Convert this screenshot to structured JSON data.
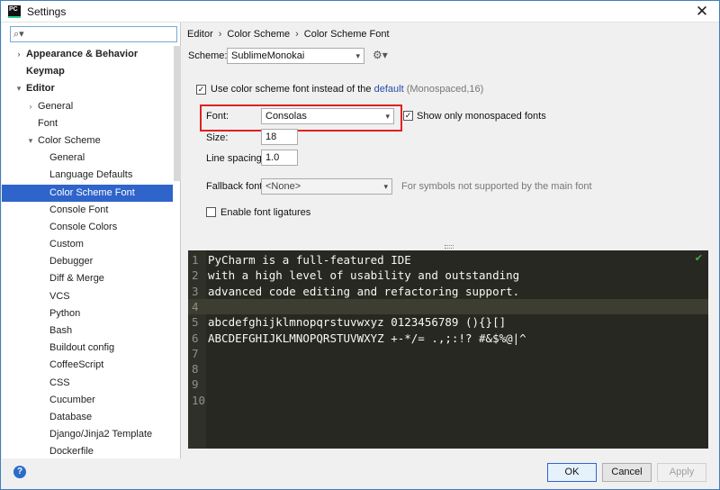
{
  "window": {
    "title": "Settings",
    "app_icon_text": "PC"
  },
  "sidebar": {
    "search": {
      "value": "",
      "placeholder": ""
    },
    "items": [
      {
        "label": "Appearance & Behavior",
        "level": 0,
        "bold": true,
        "arrow": "right"
      },
      {
        "label": "Keymap",
        "level": 0,
        "bold": true,
        "arrow": ""
      },
      {
        "label": "Editor",
        "level": 0,
        "bold": true,
        "arrow": "down"
      },
      {
        "label": "General",
        "level": 1,
        "bold": false,
        "arrow": "right"
      },
      {
        "label": "Font",
        "level": 1,
        "bold": false,
        "arrow": ""
      },
      {
        "label": "Color Scheme",
        "level": 1,
        "bold": false,
        "arrow": "down"
      },
      {
        "label": "General",
        "level": 2,
        "bold": false,
        "arrow": ""
      },
      {
        "label": "Language Defaults",
        "level": 2,
        "bold": false,
        "arrow": ""
      },
      {
        "label": "Color Scheme Font",
        "level": 2,
        "bold": false,
        "arrow": "",
        "selected": true
      },
      {
        "label": "Console Font",
        "level": 2,
        "bold": false,
        "arrow": ""
      },
      {
        "label": "Console Colors",
        "level": 2,
        "bold": false,
        "arrow": ""
      },
      {
        "label": "Custom",
        "level": 2,
        "bold": false,
        "arrow": ""
      },
      {
        "label": "Debugger",
        "level": 2,
        "bold": false,
        "arrow": ""
      },
      {
        "label": "Diff & Merge",
        "level": 2,
        "bold": false,
        "arrow": ""
      },
      {
        "label": "VCS",
        "level": 2,
        "bold": false,
        "arrow": ""
      },
      {
        "label": "Python",
        "level": 2,
        "bold": false,
        "arrow": ""
      },
      {
        "label": "Bash",
        "level": 2,
        "bold": false,
        "arrow": ""
      },
      {
        "label": "Buildout config",
        "level": 2,
        "bold": false,
        "arrow": ""
      },
      {
        "label": "CoffeeScript",
        "level": 2,
        "bold": false,
        "arrow": ""
      },
      {
        "label": "CSS",
        "level": 2,
        "bold": false,
        "arrow": ""
      },
      {
        "label": "Cucumber",
        "level": 2,
        "bold": false,
        "arrow": ""
      },
      {
        "label": "Database",
        "level": 2,
        "bold": false,
        "arrow": ""
      },
      {
        "label": "Django/Jinja2 Template",
        "level": 2,
        "bold": false,
        "arrow": ""
      },
      {
        "label": "Dockerfile",
        "level": 2,
        "bold": false,
        "arrow": ""
      }
    ]
  },
  "breadcrumb": {
    "part1": "Editor",
    "part2": "Color Scheme",
    "part3": "Color Scheme Font",
    "separator": "›"
  },
  "scheme": {
    "label": "Scheme:",
    "value": "SublimeMonokai"
  },
  "use_scheme_font": {
    "checked": true,
    "label": "Use color scheme font instead of the",
    "link": "default",
    "hint": "(Monospaced,16)"
  },
  "font": {
    "label": "Font:",
    "value": "Consolas"
  },
  "show_monospaced": {
    "checked": true,
    "label": "Show only monospaced fonts"
  },
  "size": {
    "label": "Size:",
    "value": "18"
  },
  "line_spacing": {
    "label": "Line spacing:",
    "value": "1.0"
  },
  "fallback_font": {
    "label": "Fallback font:",
    "value": "<None>",
    "hint": "For symbols not supported by the main font"
  },
  "ligatures": {
    "checked": false,
    "label": "Enable font ligatures"
  },
  "preview": {
    "lines": [
      {
        "num": "1",
        "text": "PyCharm is a full-featured IDE"
      },
      {
        "num": "2",
        "text": "with a high level of usability and outstanding"
      },
      {
        "num": "3",
        "text": "advanced code editing and refactoring support."
      },
      {
        "num": "4",
        "text": ""
      },
      {
        "num": "5",
        "text": "abcdefghijklmnopqrstuvwxyz 0123456789 (){}[]"
      },
      {
        "num": "6",
        "text": "ABCDEFGHIJKLMNOPQRSTUVWXYZ +-*/= .,;:!? #&$%@|^"
      },
      {
        "num": "7",
        "text": ""
      },
      {
        "num": "8",
        "text": ""
      },
      {
        "num": "9",
        "text": ""
      },
      {
        "num": "10",
        "text": ""
      }
    ],
    "current_line": "4"
  },
  "buttons": {
    "ok": "OK",
    "cancel": "Cancel",
    "apply": "Apply"
  },
  "icons": {
    "app": "pycharm-icon",
    "close": "close-icon",
    "search": "search-icon",
    "gear": "gear-icon",
    "help": "help-icon",
    "check": "check-icon"
  },
  "colors": {
    "accent": "#2f65ca",
    "highlight_border": "#e02020",
    "editor_bg": "#272822",
    "editor_fg": "#f8f8f2"
  }
}
